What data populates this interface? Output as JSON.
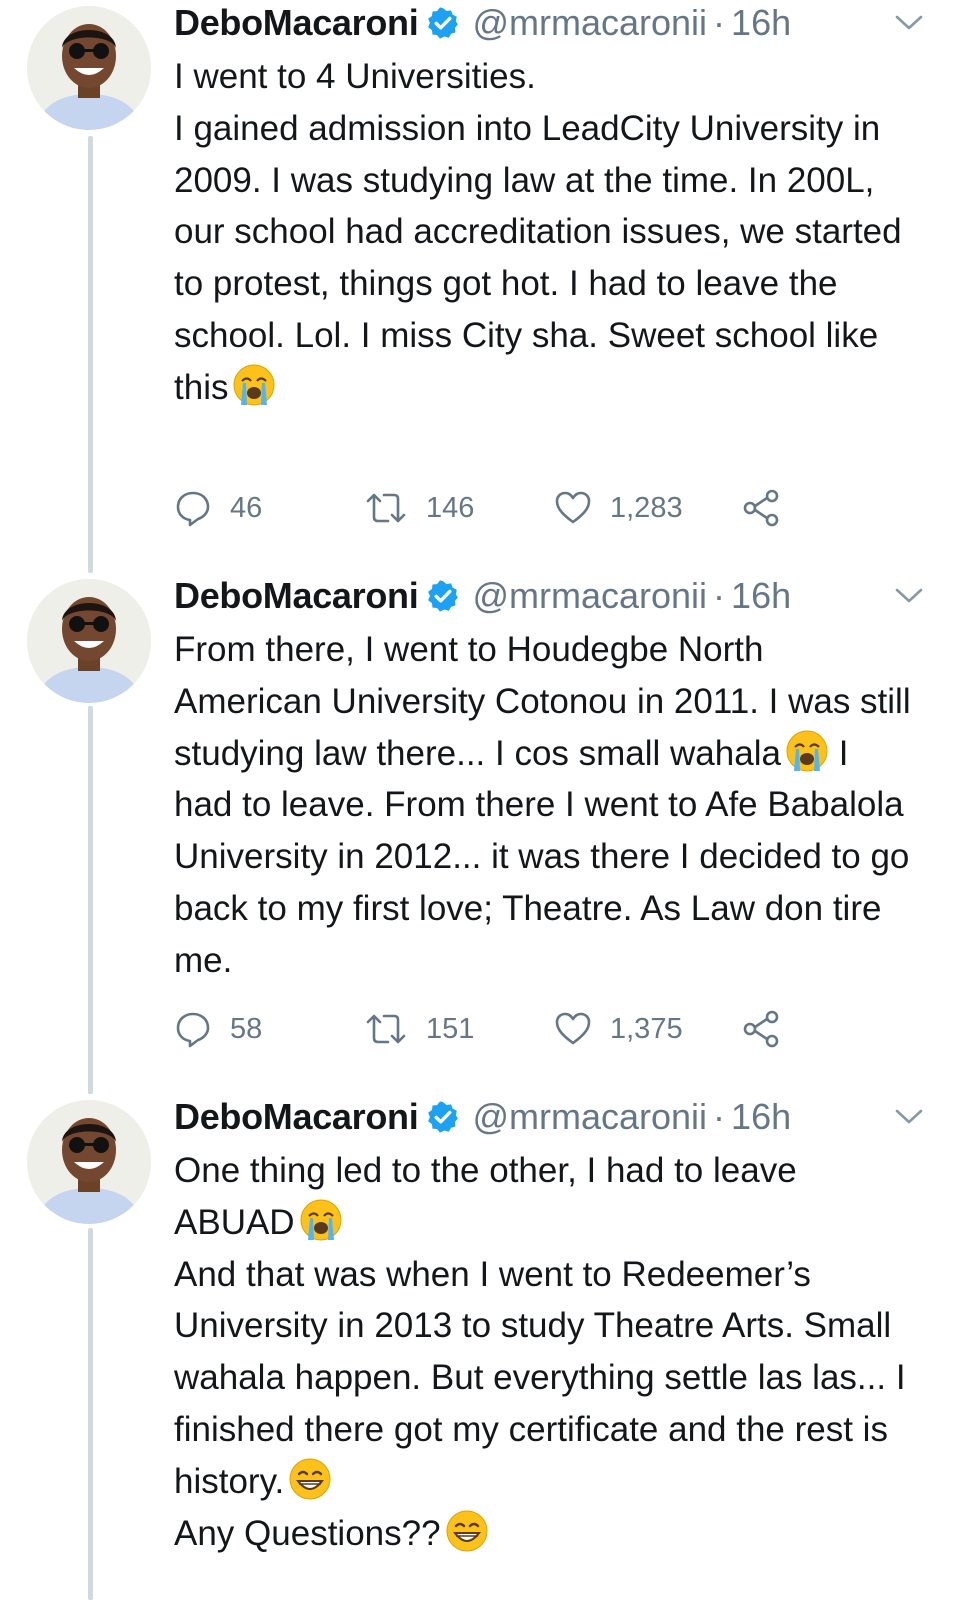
{
  "author": {
    "display_name": "DeboMacaroni",
    "handle": "@mrmacaronii",
    "time": "16h",
    "verified_color": "#1da1f2"
  },
  "icons": {
    "verified": "verified-badge-icon",
    "caret": "chevron-down-icon",
    "reply": "reply-icon",
    "retweet": "retweet-icon",
    "like": "heart-icon",
    "share": "share-icon",
    "emoji_crying": "loudly-crying-face-emoji",
    "emoji_grin": "grinning-face-emoji"
  },
  "tweets": [
    {
      "line1": "I went to 4 Universities.",
      "line2": "I gained admission into LeadCity University in 2009. I was studying law at the time. In 200L, our school had accreditation issues, we started to protest, things got hot. I had to leave the school. Lol. I miss City sha. Sweet school like this",
      "replies": "46",
      "retweets": "146",
      "likes": "1,283"
    },
    {
      "part1": "From there, I went to Houdegbe North American University Cotonou in 2011. I was still studying law there... I cos small wahala",
      "part2": "I had to leave. From there I went to Afe Babalola University in 2012... it was there I decided to go back to my first love; Theatre. As Law don tire me.",
      "replies": "58",
      "retweets": "151",
      "likes": "1,375"
    },
    {
      "line1": "One thing led to the other, I had to leave ABUAD",
      "line2": "And that was when I went to Redeemer’s University in 2013 to study Theatre Arts. Small wahala happen. But everything settle las las... I finished there got my certificate and the rest is history.",
      "line3": "Any Questions??"
    }
  ]
}
